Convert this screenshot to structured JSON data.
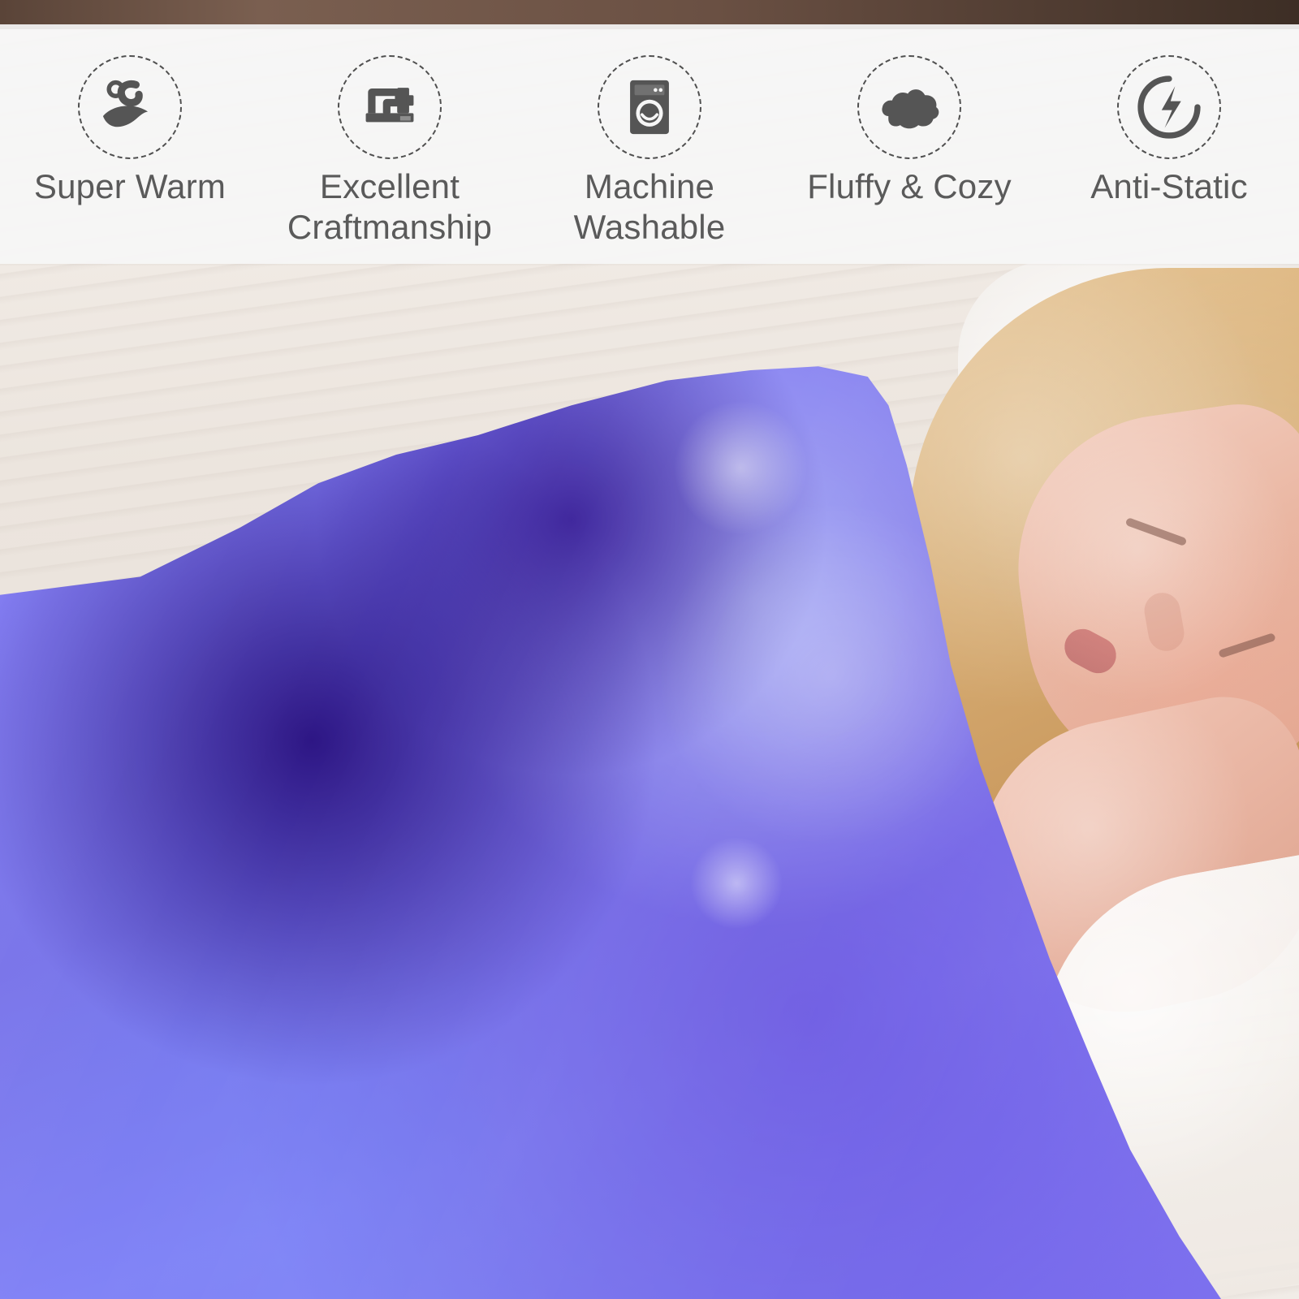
{
  "features": [
    {
      "title_lines": [
        "Super Warm"
      ],
      "icon": "warm-temperature-icon"
    },
    {
      "title_lines": [
        "Excellent",
        "Craftmanship"
      ],
      "icon": "sewing-machine-icon"
    },
    {
      "title_lines": [
        "Machine",
        "Washable"
      ],
      "icon": "washing-machine-icon"
    },
    {
      "title_lines": [
        "Fluffy & Cozy"
      ],
      "icon": "cloud-icon"
    },
    {
      "title_lines": [
        "Anti-Static"
      ],
      "icon": "lightning-icon"
    }
  ],
  "colors": {
    "banner_bg": "#f6f6f6",
    "icon_gray": "#555555",
    "text_gray": "#5a5a5a",
    "blanket_purple": "#7e78e8"
  }
}
